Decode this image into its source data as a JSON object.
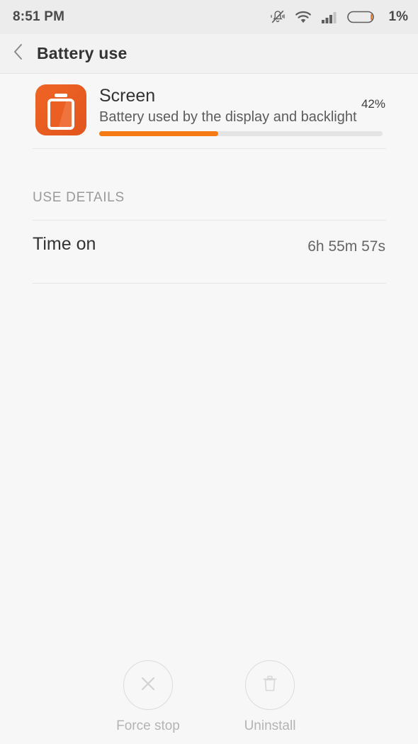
{
  "status_bar": {
    "time": "8:51 PM",
    "battery_percent": "1%",
    "icons": [
      "vibrate-off-icon",
      "wifi-icon",
      "cellular-signal-icon",
      "battery-icon"
    ]
  },
  "title_bar": {
    "back_icon": "chevron-left-icon",
    "title": "Battery use"
  },
  "app_summary": {
    "icon": "screen-battery-icon",
    "name": "Screen",
    "description": "Battery used by the display and backlight",
    "percent_label": "42%",
    "usage_percent": 42,
    "accent_color": "#f57a14",
    "icon_color": "#e9551d"
  },
  "use_details": {
    "section_label": "USE DETAILS",
    "rows": [
      {
        "label": "Time on",
        "value": "6h 55m 57s"
      }
    ]
  },
  "actions": [
    {
      "icon": "close-x-icon",
      "label": "Force stop",
      "enabled": false
    },
    {
      "icon": "trash-icon",
      "label": "Uninstall",
      "enabled": false
    }
  ]
}
